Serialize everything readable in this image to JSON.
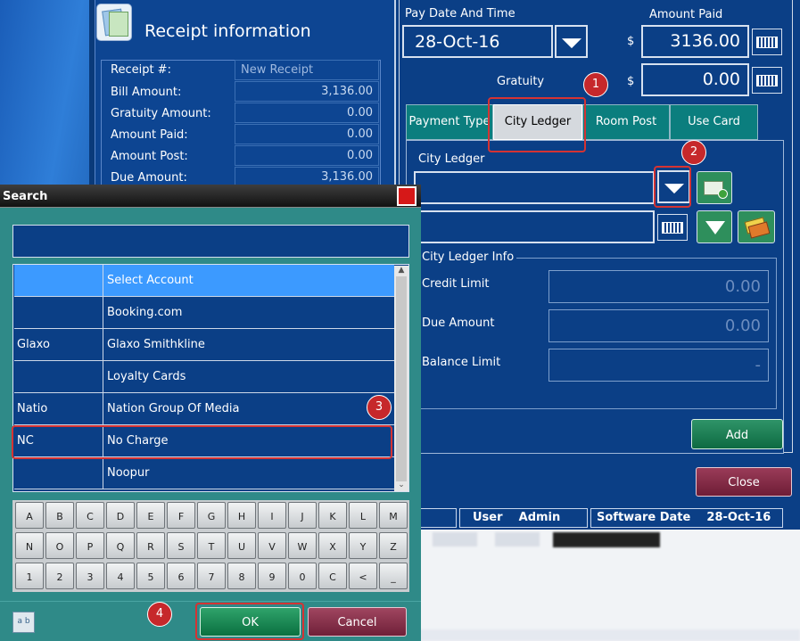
{
  "receipt": {
    "title": "Receipt information",
    "labels": [
      "Receipt #:",
      "Bill Amount:",
      "Gratuity Amount:",
      "Amount Paid:",
      "Amount Post:",
      "Due Amount:"
    ],
    "values": [
      "New Receipt",
      "3,136.00",
      "0.00",
      "0.00",
      "0.00",
      "3,136.00"
    ]
  },
  "payment": {
    "pay_date_label": "Pay Date And Time",
    "pay_date_value": "28-Oct-16",
    "amount_paid_label": "Amount Paid",
    "currency": "$",
    "amount_paid_value": "3136.00",
    "gratuity_label": "Gratuity",
    "gratuity_value": "0.00"
  },
  "tabs": [
    "Payment Type",
    "City Ledger",
    "Room Post",
    "Use Card"
  ],
  "city_ledger": {
    "label": "City Ledger",
    "info_label": "City Ledger Info",
    "credit_limit_label": "Credit Limit",
    "credit_limit_value": "0.00",
    "due_amount_label": "Due Amount",
    "due_amount_value": "0.00",
    "balance_limit_label": "Balance Limit",
    "balance_limit_value": "-",
    "add_label": "Add"
  },
  "close_label": "Close",
  "status": {
    "user_label": "User",
    "user_value": "Admin",
    "software_date_label": "Software Date",
    "software_date_value": "28-Oct-16"
  },
  "markers": [
    "1",
    "2",
    "3",
    "4"
  ],
  "dialog": {
    "title": "Search",
    "header": "Select Account",
    "rows": [
      {
        "code": "",
        "name": "Booking.com"
      },
      {
        "code": "Glaxo",
        "name": "Glaxo Smithkline"
      },
      {
        "code": "",
        "name": "Loyalty Cards"
      },
      {
        "code": "Natio",
        "name": "Nation Group Of Media"
      },
      {
        "code": "NC",
        "name": "No Charge"
      },
      {
        "code": "",
        "name": "Noopur"
      }
    ],
    "keys_row1": [
      "A",
      "B",
      "C",
      "D",
      "E",
      "F",
      "G",
      "H",
      "I",
      "J",
      "K",
      "L",
      "M"
    ],
    "keys_row2": [
      "N",
      "O",
      "P",
      "Q",
      "R",
      "S",
      "T",
      "U",
      "V",
      "W",
      "X",
      "Y",
      "Z"
    ],
    "keys_row3": [
      "1",
      "2",
      "3",
      "4",
      "5",
      "6",
      "7",
      "8",
      "9",
      "0",
      "C",
      "<",
      "_"
    ],
    "ok_label": "OK",
    "cancel_label": "Cancel",
    "ab_icon_text": "a b"
  },
  "colors": {
    "app_blue": "#0b3f86",
    "teal": "#2f8a88",
    "marker_red": "#c6282b"
  }
}
